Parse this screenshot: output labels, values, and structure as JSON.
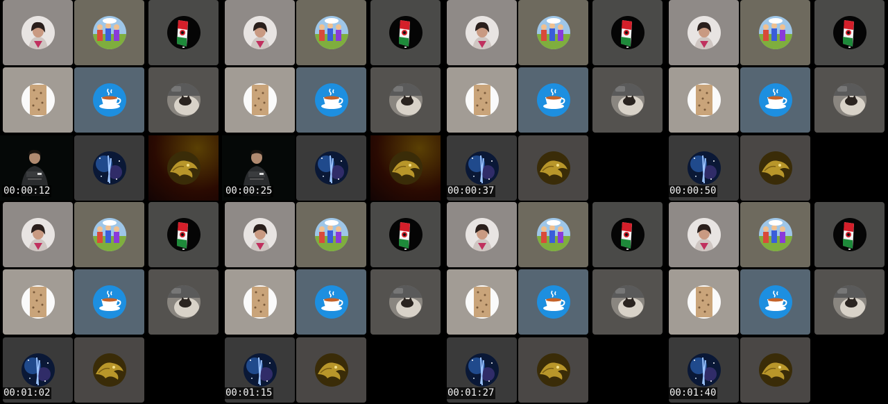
{
  "frames": [
    {
      "timestamp": "00:00:12",
      "tiles": [
        "woman",
        "cartoon",
        "flag",
        "bread",
        "tea",
        "cat",
        "camera",
        "galaxy",
        "dragon-red"
      ]
    },
    {
      "timestamp": "00:00:25",
      "tiles": [
        "woman",
        "cartoon",
        "flag",
        "bread",
        "tea",
        "cat",
        "camera",
        "galaxy",
        "dragon-red"
      ]
    },
    {
      "timestamp": "00:00:37",
      "tiles": [
        "woman",
        "cartoon",
        "flag",
        "bread",
        "tea",
        "cat",
        "galaxy",
        "dragon"
      ]
    },
    {
      "timestamp": "00:00:50",
      "tiles": [
        "woman",
        "cartoon",
        "flag",
        "bread",
        "tea",
        "cat",
        "galaxy",
        "dragon"
      ]
    },
    {
      "timestamp": "00:01:02",
      "tiles": [
        "woman",
        "cartoon",
        "flag",
        "bread",
        "tea",
        "cat",
        "galaxy",
        "dragon"
      ]
    },
    {
      "timestamp": "00:01:15",
      "tiles": [
        "woman",
        "cartoon",
        "flag",
        "bread",
        "tea",
        "cat",
        "galaxy",
        "dragon"
      ]
    },
    {
      "timestamp": "00:01:27",
      "tiles": [
        "woman",
        "cartoon",
        "flag",
        "bread",
        "tea",
        "cat",
        "galaxy",
        "dragon"
      ]
    },
    {
      "timestamp": "00:01:40",
      "tiles": [
        "woman",
        "cartoon",
        "flag",
        "bread",
        "tea",
        "cat",
        "galaxy",
        "dragon"
      ]
    }
  ],
  "tile_kinds": {
    "woman": {
      "name": "participant-woman-avatar",
      "bg": "#8f8a87",
      "icon": "woman-portrait-icon"
    },
    "cartoon": {
      "name": "participant-cartoon-avatar",
      "bg": "#6e6a5e",
      "icon": "cartoon-scene-icon"
    },
    "flag": {
      "name": "participant-flag-avatar",
      "bg": "#4a4a48",
      "icon": "flag-emblem-icon"
    },
    "bread": {
      "name": "participant-bread-avatar",
      "bg": "#a29c95",
      "icon": "bread-icon"
    },
    "tea": {
      "name": "participant-tea-avatar",
      "bg": "#566673",
      "icon": "teacup-icon"
    },
    "cat": {
      "name": "participant-cat-avatar",
      "bg": "#54524f",
      "icon": "cat-photo-icon"
    },
    "camera": {
      "name": "participant-camera-video",
      "bg": "#050807",
      "icon": "person-video-icon"
    },
    "galaxy": {
      "name": "participant-galaxy-avatar",
      "bg": "#3a3a3a",
      "icon": "galaxy-icon"
    },
    "dragon": {
      "name": "participant-dragon-avatar",
      "bg": "#4a4745",
      "icon": "dragon-icon"
    },
    "dragon-red": {
      "name": "participant-dragon-avatar",
      "bg": "#1a0f05",
      "icon": "dragon-icon"
    }
  }
}
